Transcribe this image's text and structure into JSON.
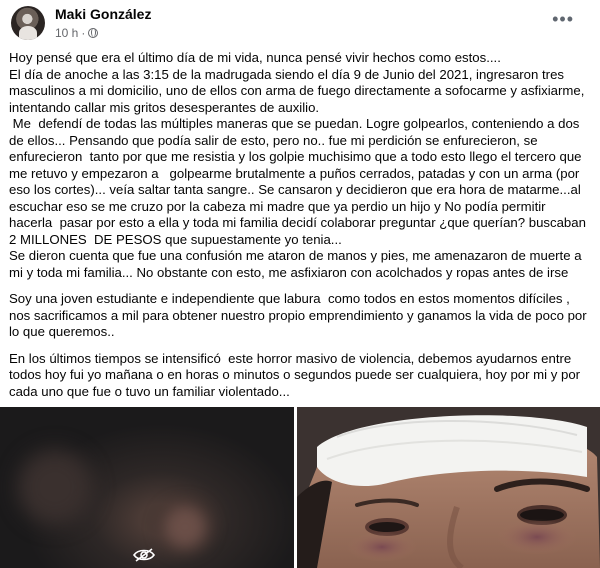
{
  "post": {
    "author": "Maki González",
    "time": "10 h",
    "separator": "·",
    "more_icon": "more-horizontal-icon",
    "privacy_icon": "globe-icon",
    "paragraphs": [
      "Hoy pensé que era el último día de mi vida, nunca pensé vivir hechos como estos....\nEl día de anoche a las 3:15 de la madrugada siendo el día 9 de Junio del 2021, ingresaron tres masculinos a mi domicilio, uno de ellos con arma de fuego directamente a sofocarme y asfixiarme, intentando callar mis gritos desesperantes de auxilio.\n Me  defendí de todas las múltiples maneras que se puedan. Logre golpearlos, conteniendo a dos de ellos... Pensando que podía salir de esto, pero no.. fue mi perdición se enfurecieron, se enfurecieron  tanto por que me resistia y los golpie muchisimo que a todo esto llego el tercero que me retuvo y empezaron a   golpearme brutalmente a puños cerrados, patadas y con un arma (por eso los cortes)... veía saltar tanta sangre.. Se cansaron y decidieron que era hora de matarme...al escuchar eso se me cruzo por la cabeza mi madre que ya perdio un hijo y No podía permitir hacerla  pasar por esto a ella y toda mi familia decidí colaborar preguntar ¿que querían? buscaban 2 MILLONES  DE PESOS que supuestamente yo tenia...\nSe dieron cuenta que fue una confusión me ataron de manos y pies, me amenazaron de muerte a mi y toda mi familia... No obstante con esto, me asfixiaron con acolchados y ropas antes de irse",
      "Soy una joven estudiante e independiente que labura  como todos en estos momentos difíciles , nos sacrificamos a mil para obtener nuestro propio emprendimiento y ganamos la vida de poco por lo que queremos..",
      "En los últimos tiempos se intensificó  este horror masivo de violencia, debemos ayudarnos entre todos hoy fui yo mañana o en horas o minutos o segundos puede ser cualquiera, hoy por mi y por cada uno que fue o tuvo un familiar violentado..."
    ],
    "photos": [
      {
        "icon": "eye-off-icon"
      },
      {
        "icon": "none"
      }
    ]
  },
  "colors": {
    "text": "#050505",
    "meta": "#65676b",
    "background": "#ffffff"
  }
}
